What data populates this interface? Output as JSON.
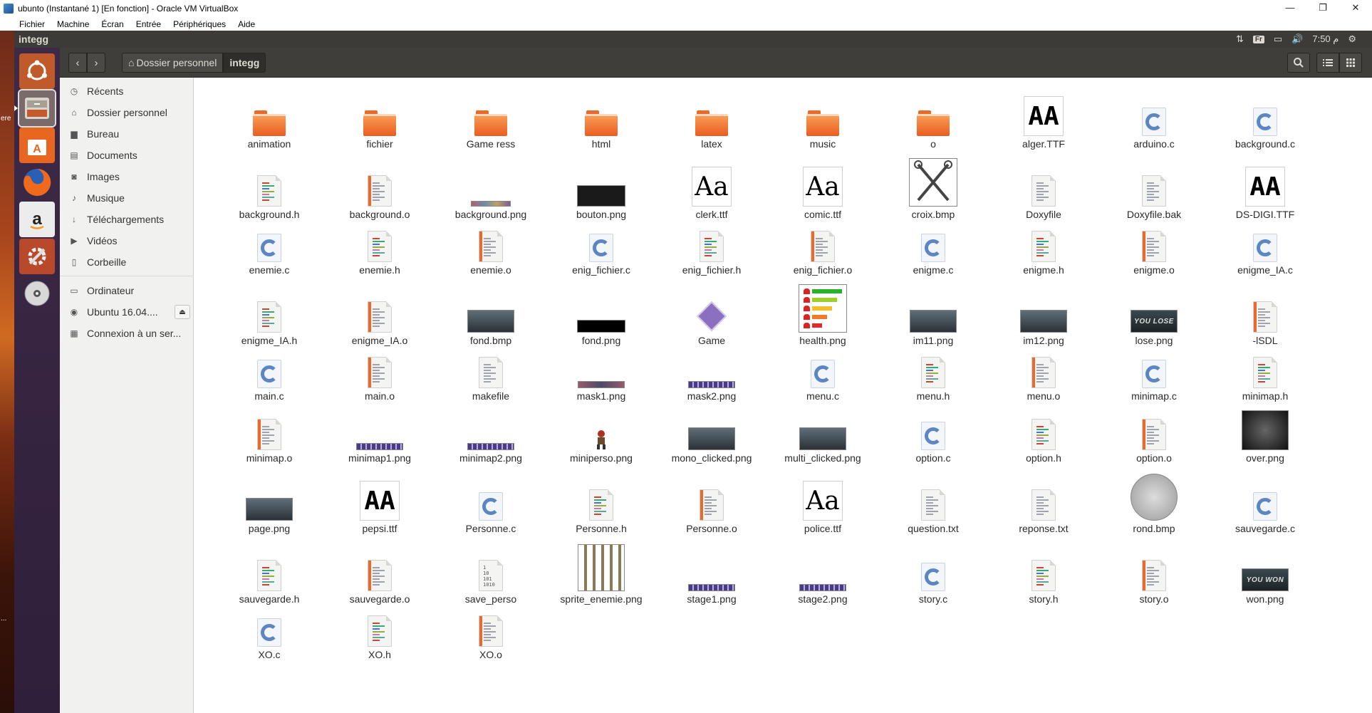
{
  "vbox": {
    "title": "ubunto (Instantané 1) [En fonction] - Oracle VM VirtualBox",
    "menu": [
      "Fichier",
      "Machine",
      "Écran",
      "Entrée",
      "Périphériques",
      "Aide"
    ],
    "controls": [
      "—",
      "❐",
      "✕"
    ]
  },
  "host": {
    "edge_texts": [
      "ere",
      "..."
    ]
  },
  "topbar": {
    "app_name": "integg",
    "time": "7:50 م",
    "kbd_layout": "Fr"
  },
  "header": {
    "back": "‹",
    "forward": "›",
    "breadcrumbs": [
      "Dossier personnel",
      "integg"
    ],
    "home_glyph": "⌂"
  },
  "sidebar": {
    "items": [
      {
        "label": "Récents",
        "icon": "clock-icon",
        "glyph": "◷"
      },
      {
        "label": "Dossier personnel",
        "icon": "home-icon",
        "glyph": "⌂"
      },
      {
        "label": "Bureau",
        "icon": "desktop-icon",
        "glyph": "▆"
      },
      {
        "label": "Documents",
        "icon": "documents-icon",
        "glyph": "▤"
      },
      {
        "label": "Images",
        "icon": "camera-icon",
        "glyph": "◙"
      },
      {
        "label": "Musique",
        "icon": "music-icon",
        "glyph": "♪"
      },
      {
        "label": "Téléchargements",
        "icon": "download-icon",
        "glyph": "↓"
      },
      {
        "label": "Vidéos",
        "icon": "video-icon",
        "glyph": "▶"
      },
      {
        "label": "Corbeille",
        "icon": "trash-icon",
        "glyph": "▯"
      },
      {
        "label": "Ordinateur",
        "icon": "computer-icon",
        "glyph": "▭"
      },
      {
        "label": "Ubuntu 16.04....",
        "icon": "disc-icon",
        "glyph": "◉"
      },
      {
        "label": "Connexion à un ser...",
        "icon": "network-icon",
        "glyph": "▦"
      }
    ],
    "eject_glyph": "⏏"
  },
  "files": [
    {
      "name": "animation",
      "type": "folder"
    },
    {
      "name": "fichier",
      "type": "folder"
    },
    {
      "name": "Game ress",
      "type": "folder"
    },
    {
      "name": "html",
      "type": "folder"
    },
    {
      "name": "latex",
      "type": "folder"
    },
    {
      "name": "music",
      "type": "folder"
    },
    {
      "name": "o",
      "type": "folder"
    },
    {
      "name": "alger.TTF",
      "type": "font",
      "sample": "AA"
    },
    {
      "name": "arduino.c",
      "type": "c"
    },
    {
      "name": "background.c",
      "type": "c"
    },
    {
      "name": "background.h",
      "type": "h"
    },
    {
      "name": "background.o",
      "type": "o"
    },
    {
      "name": "background.png",
      "type": "img-strip"
    },
    {
      "name": "bouton.png",
      "type": "img-dark"
    },
    {
      "name": "clerk.ttf",
      "type": "font",
      "sample": "Aa"
    },
    {
      "name": "comic.ttf",
      "type": "font",
      "sample": "Aa"
    },
    {
      "name": "croix.bmp",
      "type": "img-croix"
    },
    {
      "name": "Doxyfile",
      "type": "txt"
    },
    {
      "name": "Doxyfile.bak",
      "type": "txt"
    },
    {
      "name": "DS-DIGI.TTF",
      "type": "font",
      "sample": "AA"
    },
    {
      "name": "enemie.c",
      "type": "c"
    },
    {
      "name": "enemie.h",
      "type": "h"
    },
    {
      "name": "enemie.o",
      "type": "o"
    },
    {
      "name": "enig_fichier.c",
      "type": "c"
    },
    {
      "name": "enig_fichier.h",
      "type": "h"
    },
    {
      "name": "enig_fichier.o",
      "type": "o"
    },
    {
      "name": "enigme.c",
      "type": "c"
    },
    {
      "name": "enigme.h",
      "type": "h"
    },
    {
      "name": "enigme.o",
      "type": "o"
    },
    {
      "name": "enigme_IA.c",
      "type": "c"
    },
    {
      "name": "enigme_IA.h",
      "type": "h"
    },
    {
      "name": "enigme_IA.o",
      "type": "o"
    },
    {
      "name": "fond.bmp",
      "type": "img-scene"
    },
    {
      "name": "fond.png",
      "type": "img-black"
    },
    {
      "name": "Game",
      "type": "game"
    },
    {
      "name": "health.png",
      "type": "img-health"
    },
    {
      "name": "im11.png",
      "type": "img-scene"
    },
    {
      "name": "im12.png",
      "type": "img-scene"
    },
    {
      "name": "lose.png",
      "type": "img-text",
      "text": "YOU LOSE"
    },
    {
      "name": "-lSDL",
      "type": "o"
    },
    {
      "name": "main.c",
      "type": "c"
    },
    {
      "name": "main.o",
      "type": "o"
    },
    {
      "name": "makefile",
      "type": "txt"
    },
    {
      "name": "mask1.png",
      "type": "img-mask"
    },
    {
      "name": "mask2.png",
      "type": "img-mask2"
    },
    {
      "name": "menu.c",
      "type": "c"
    },
    {
      "name": "menu.h",
      "type": "h"
    },
    {
      "name": "menu.o",
      "type": "o"
    },
    {
      "name": "minimap.c",
      "type": "c"
    },
    {
      "name": "minimap.h",
      "type": "h"
    },
    {
      "name": "minimap.o",
      "type": "o"
    },
    {
      "name": "minimap1.png",
      "type": "img-mask2"
    },
    {
      "name": "minimap2.png",
      "type": "img-mask2"
    },
    {
      "name": "miniperso.png",
      "type": "img-perso"
    },
    {
      "name": "mono_clicked.png",
      "type": "img-scene"
    },
    {
      "name": "multi_clicked.png",
      "type": "img-scene"
    },
    {
      "name": "option.c",
      "type": "c"
    },
    {
      "name": "option.h",
      "type": "h"
    },
    {
      "name": "option.o",
      "type": "o"
    },
    {
      "name": "over.png",
      "type": "img-over"
    },
    {
      "name": "page.png",
      "type": "img-scene"
    },
    {
      "name": "pepsi.ttf",
      "type": "font",
      "sample": "AA"
    },
    {
      "name": "Personne.c",
      "type": "c"
    },
    {
      "name": "Personne.h",
      "type": "h"
    },
    {
      "name": "Personne.o",
      "type": "o"
    },
    {
      "name": "police.ttf",
      "type": "font",
      "sample": "Aa"
    },
    {
      "name": "question.txt",
      "type": "txt"
    },
    {
      "name": "reponse.txt",
      "type": "txt"
    },
    {
      "name": "rond.bmp",
      "type": "img-rond"
    },
    {
      "name": "sauvegarde.c",
      "type": "c"
    },
    {
      "name": "sauvegarde.h",
      "type": "h"
    },
    {
      "name": "sauvegarde.o",
      "type": "o"
    },
    {
      "name": "save_perso",
      "type": "bin"
    },
    {
      "name": "sprite_enemie.png",
      "type": "img-sprite"
    },
    {
      "name": "stage1.png",
      "type": "img-mask2"
    },
    {
      "name": "stage2.png",
      "type": "img-mask2"
    },
    {
      "name": "story.c",
      "type": "c"
    },
    {
      "name": "story.h",
      "type": "h"
    },
    {
      "name": "story.o",
      "type": "o"
    },
    {
      "name": "won.png",
      "type": "img-text",
      "text": "YOU WON"
    },
    {
      "name": "XO.c",
      "type": "c"
    },
    {
      "name": "XO.h",
      "type": "h"
    },
    {
      "name": "XO.o",
      "type": "o"
    }
  ]
}
